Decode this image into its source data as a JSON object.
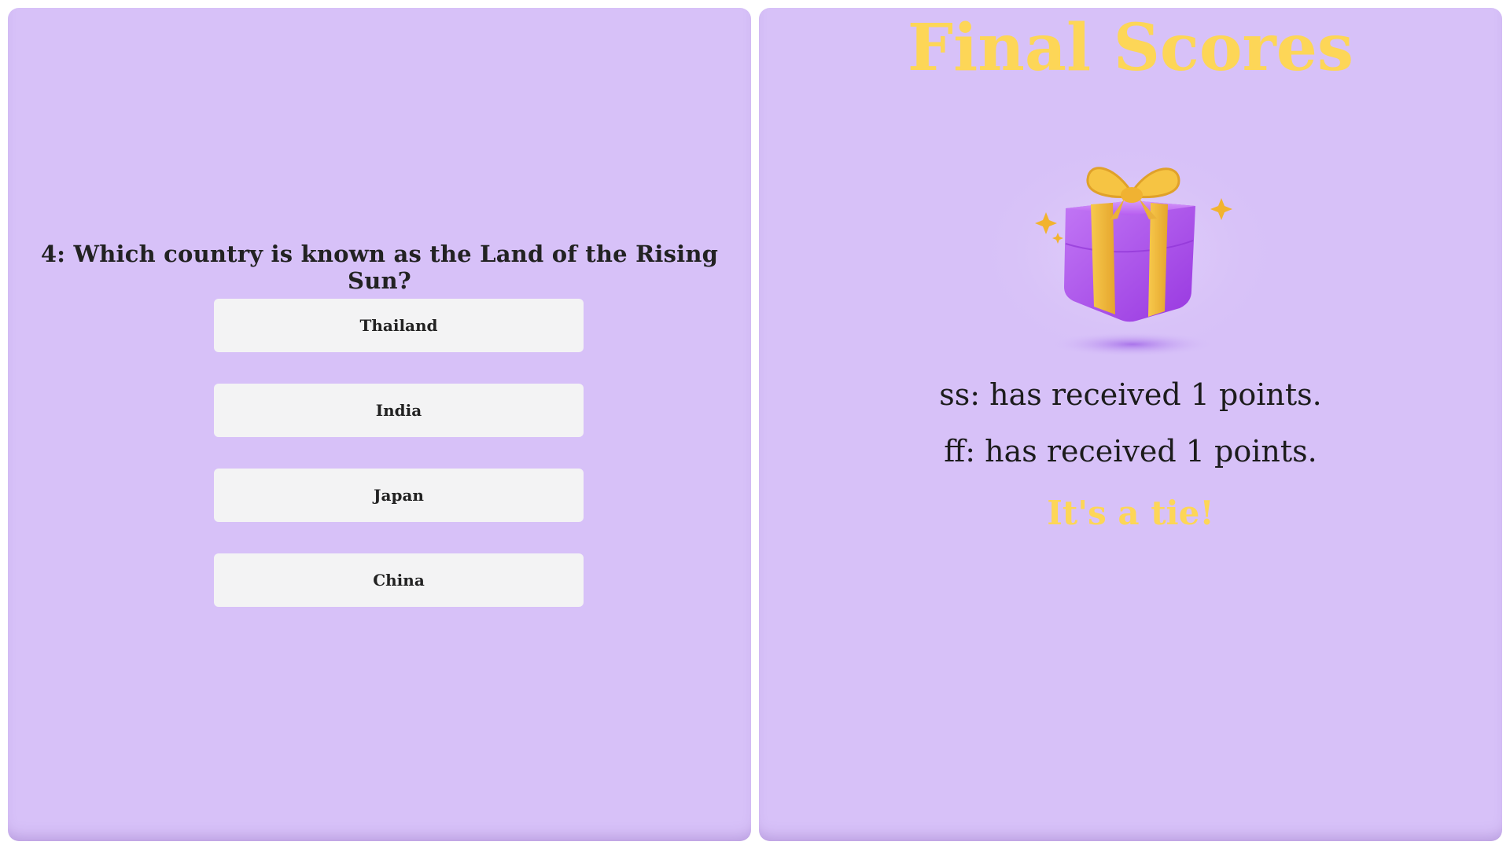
{
  "quiz": {
    "question": "4: Which country is known as the Land of the Rising Sun?",
    "answers": [
      "Thailand",
      "India",
      "Japan",
      "China"
    ]
  },
  "results": {
    "title": "Final Scores",
    "image_icon": "gift-box-icon",
    "scores": [
      "ss: has received 1 points.",
      "ff: has received 1 points."
    ],
    "outcome": "It's a tie!"
  },
  "colors": {
    "panel_bg": "#d7c1f8",
    "accent_yellow": "#fdd657",
    "button_bg": "#f3f3f4",
    "gift_purple": "#b050ee",
    "ribbon_gold": "#f2b93c"
  }
}
